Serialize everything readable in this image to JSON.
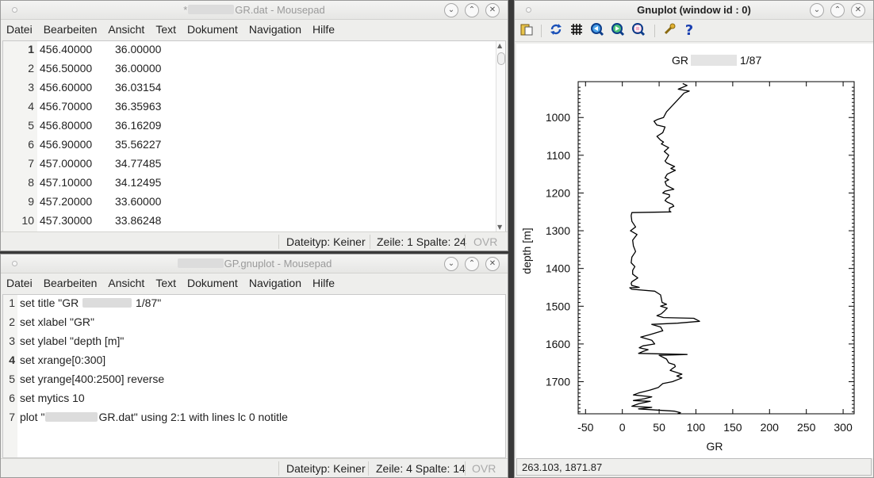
{
  "dat_window": {
    "title_prefix": "*",
    "title_suffix": "GR.dat - Mousepad",
    "menu": [
      "Datei",
      "Bearbeiten",
      "Ansicht",
      "Text",
      "Dokument",
      "Navigation",
      "Hilfe"
    ],
    "rows": [
      {
        "n": "1",
        "a": "456.40000",
        "b": "36.00000"
      },
      {
        "n": "2",
        "a": "456.50000",
        "b": "36.00000"
      },
      {
        "n": "3",
        "a": "456.60000",
        "b": "36.03154"
      },
      {
        "n": "4",
        "a": "456.70000",
        "b": "36.35963"
      },
      {
        "n": "5",
        "a": "456.80000",
        "b": "36.16209"
      },
      {
        "n": "6",
        "a": "456.90000",
        "b": "35.56227"
      },
      {
        "n": "7",
        "a": "457.00000",
        "b": "34.77485"
      },
      {
        "n": "8",
        "a": "457.10000",
        "b": "34.12495"
      },
      {
        "n": "9",
        "a": "457.20000",
        "b": "33.60000"
      },
      {
        "n": "10",
        "a": "457.30000",
        "b": "33.86248"
      }
    ],
    "status": {
      "filetype": "Dateityp: Keiner",
      "position": "Zeile: 1 Spalte: 24",
      "ovr": "OVR"
    }
  },
  "gp_window": {
    "title_suffix": "GP.gnuplot - Mousepad",
    "menu": [
      "Datei",
      "Bearbeiten",
      "Ansicht",
      "Text",
      "Dokument",
      "Navigation",
      "Hilfe"
    ],
    "lines": [
      {
        "n": "1",
        "pre": "set title \"GR ",
        "post": " 1/87\""
      },
      {
        "n": "2",
        "pre": "set xlabel \"GR\"",
        "post": ""
      },
      {
        "n": "3",
        "pre": "set ylabel \"depth [m]\"",
        "post": ""
      },
      {
        "n": "4",
        "pre": "set xrange[0:300]",
        "post": ""
      },
      {
        "n": "5",
        "pre": "set yrange[400:2500] reverse",
        "post": ""
      },
      {
        "n": "6",
        "pre": "set mytics 10",
        "post": ""
      },
      {
        "n": "7",
        "pre": "plot \"",
        "post": "GR.dat\" using 2:1 with lines lc 0 notitle"
      }
    ],
    "status": {
      "filetype": "Dateityp: Keiner",
      "position": "Zeile: 4 Spalte: 14",
      "ovr": "OVR"
    }
  },
  "plot_window": {
    "title": "Gnuplot (window id : 0)",
    "toolbar_icons": [
      "copy-clipboard-icon",
      "replot-icon",
      "grid-icon",
      "zoom-previous-icon",
      "zoom-next-icon",
      "autoscale-icon",
      "configure-icon",
      "help-icon"
    ],
    "coords": "263.103,  1871.87"
  },
  "chart_data": {
    "type": "line",
    "title_prefix": "GR",
    "title_suffix": "1/87",
    "xlabel": "GR",
    "ylabel": "depth [m]",
    "xlim": [
      -60,
      315
    ],
    "ylim": [
      905,
      1785
    ],
    "y_reversed": true,
    "xticks": [
      -50,
      0,
      50,
      100,
      150,
      200,
      250,
      300
    ],
    "yticks": [
      1000,
      1100,
      1200,
      1300,
      1400,
      1500,
      1600,
      1700
    ],
    "series": [
      {
        "x": [
          82,
          88,
          76,
          91,
          84,
          60,
          56,
          48,
          43,
          47,
          58,
          57,
          55,
          47,
          52,
          56,
          53,
          63,
          57,
          63,
          60,
          58,
          60,
          71,
          66,
          72,
          61,
          58,
          63,
          58,
          60,
          70,
          58,
          55,
          64,
          64,
          60,
          58,
          62,
          68,
          70,
          64,
          64,
          66,
          13,
          12,
          13,
          18,
          11,
          20,
          14,
          15,
          18,
          13,
          12,
          17,
          14,
          14,
          21,
          13,
          12,
          13,
          23,
          10,
          13,
          44,
          52,
          53,
          54,
          60,
          52,
          61,
          56,
          53,
          47,
          56,
          97,
          105,
          75,
          40,
          52,
          55,
          38,
          25,
          40,
          44,
          28,
          23,
          35,
          28,
          22,
          88,
          50,
          60,
          63,
          71,
          72,
          68,
          65,
          81,
          74,
          81,
          68,
          55,
          52,
          49,
          38,
          22,
          15,
          40,
          30,
          15,
          38,
          23,
          17,
          13,
          40,
          22,
          45,
          71,
          79,
          75
        ],
        "y": [
          910,
          915,
          925,
          930,
          935,
          985,
          1000,
          1005,
          1010,
          1020,
          1025,
          1030,
          1040,
          1050,
          1060,
          1065,
          1070,
          1080,
          1090,
          1100,
          1110,
          1115,
          1120,
          1130,
          1135,
          1140,
          1150,
          1160,
          1165,
          1170,
          1180,
          1190,
          1195,
          1200,
          1205,
          1210,
          1215,
          1220,
          1225,
          1230,
          1235,
          1240,
          1248,
          1250,
          1252,
          1260,
          1275,
          1290,
          1300,
          1310,
          1325,
          1340,
          1355,
          1370,
          1385,
          1395,
          1405,
          1415,
          1425,
          1435,
          1440,
          1445,
          1450,
          1451,
          1455,
          1460,
          1470,
          1480,
          1490,
          1495,
          1500,
          1505,
          1515,
          1520,
          1525,
          1530,
          1532,
          1540,
          1545,
          1548,
          1555,
          1565,
          1575,
          1582,
          1590,
          1600,
          1605,
          1610,
          1615,
          1620,
          1625,
          1628,
          1630,
          1640,
          1650,
          1655,
          1660,
          1665,
          1670,
          1680,
          1685,
          1690,
          1700,
          1705,
          1710,
          1715,
          1722,
          1730,
          1735,
          1740,
          1745,
          1750,
          1752,
          1758,
          1762,
          1765,
          1768,
          1772,
          1775,
          1778,
          1782,
          1785
        ]
      }
    ]
  }
}
